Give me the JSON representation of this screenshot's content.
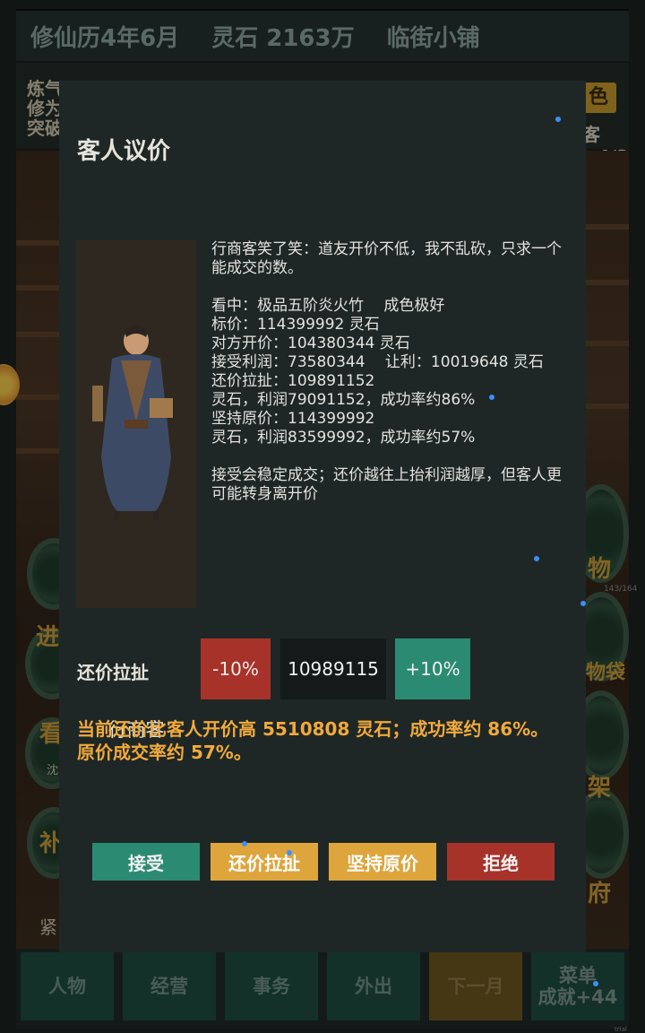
{
  "topbar": {
    "date": "修仙历4年6月",
    "stones": "灵石 2163万",
    "shop": "临街小铺"
  },
  "background": {
    "stat_lines": [
      "炼气",
      "修为",
      "突破"
    ],
    "badge": "色",
    "right_text": "客+4/3月",
    "ring_labels": [
      "物",
      "物袋",
      "架",
      "府"
    ],
    "left_ring_labels": [
      "进",
      "看",
      "补"
    ],
    "left_small": "沈",
    "bottom_left": "紧",
    "counter": "143/164",
    "watermark": "trial version"
  },
  "nav": {
    "items": [
      "人物",
      "经营",
      "事务",
      "外出",
      "下一月"
    ],
    "menu_label": "菜单",
    "achievement": "成就+44"
  },
  "modal": {
    "title": "客人议价",
    "customer_name": "行商客",
    "dialog_intro": "行商客笑了笑：道友开价不低，我不乱砍，只求一个能成交的数。",
    "item_line": "看中：极品五阶炎火竹　 成色极好",
    "list_price": "标价：114399992 灵石",
    "offer_price": "对方开价：104380344 灵石",
    "accept_profit": "接受利润：73580344　 让利：10019648 灵石",
    "counter_price": "还价拉扯：109891152",
    "counter_detail": "灵石，利润79091152，成功率约86%",
    "hold_price": "坚持原价：114399992",
    "hold_detail": "灵石，利润83599992，成功率约57%",
    "advice": "接受会稳定成交；还价越往上抬利润越厚，但客人更可能转身离开价",
    "control_label": "还价拉扯",
    "minus_label": "-10%",
    "counter_value": "10989115",
    "plus_label": "+10%",
    "summary": "当前还价比客人开价高 5510808 灵石；成功率约 86%。原价成交率约 57%。",
    "actions": {
      "accept": "接受",
      "counter": "还价拉扯",
      "hold": "坚持原价",
      "reject": "拒绝"
    }
  },
  "colors": {
    "accent_green": "#2b8a72",
    "accent_red": "#a6322a",
    "accent_gold": "#dea53c",
    "summary_orange": "#f0aa3c"
  }
}
